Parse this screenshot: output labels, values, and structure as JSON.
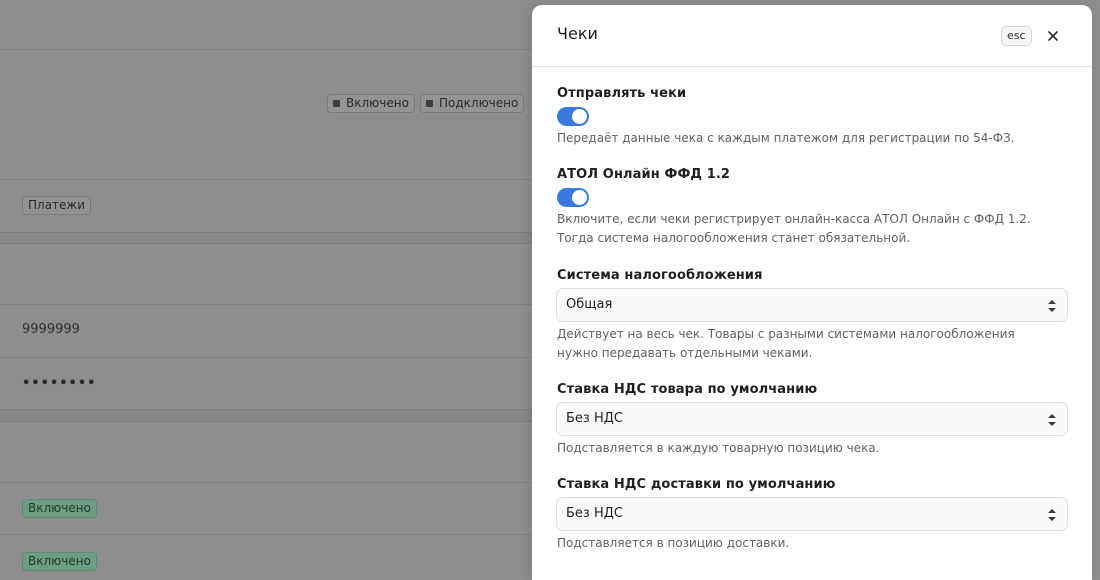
{
  "background": {
    "header_badges": [
      {
        "label": "Включено"
      },
      {
        "label": "Подключено"
      }
    ],
    "section_badge": "Платежи",
    "id_value": "9999999",
    "password_mask": "••••••••",
    "status_badges": [
      {
        "label": "Включено"
      },
      {
        "label": "Включено"
      }
    ]
  },
  "drawer": {
    "title": "Чеки",
    "esc_label": "esc",
    "fields": {
      "send_receipts": {
        "label": "Отправлять чеки",
        "enabled": true,
        "help": "Передаёт данные чека с каждым платежом для регистрации по 54-ФЗ."
      },
      "atol_ffd": {
        "label": "АТОЛ Онлайн ФФД 1.2",
        "enabled": true,
        "help": "Включите, если чеки регистрирует онлайн-касса АТОЛ Онлайн с ФФД 1.2. Тогда система налогообложения станет обязательной."
      },
      "tax_system": {
        "label": "Система налогообложения",
        "value": "Общая",
        "help": "Действует на весь чек. Товары с разными системами налогообложения нужно передавать отдельными чеками."
      },
      "vat_goods": {
        "label": "Ставка НДС товара по умолчанию",
        "value": "Без НДС",
        "help": "Подставляется в каждую товарную позицию чека."
      },
      "vat_delivery": {
        "label": "Ставка НДС доставки по умолчанию",
        "value": "Без НДС",
        "help": "Подставляется в позицию доставки."
      }
    }
  },
  "colors": {
    "overlay": "#8e8e8e",
    "toggle_on": "#3a7ae0",
    "badge_green": "#6f9d83"
  }
}
